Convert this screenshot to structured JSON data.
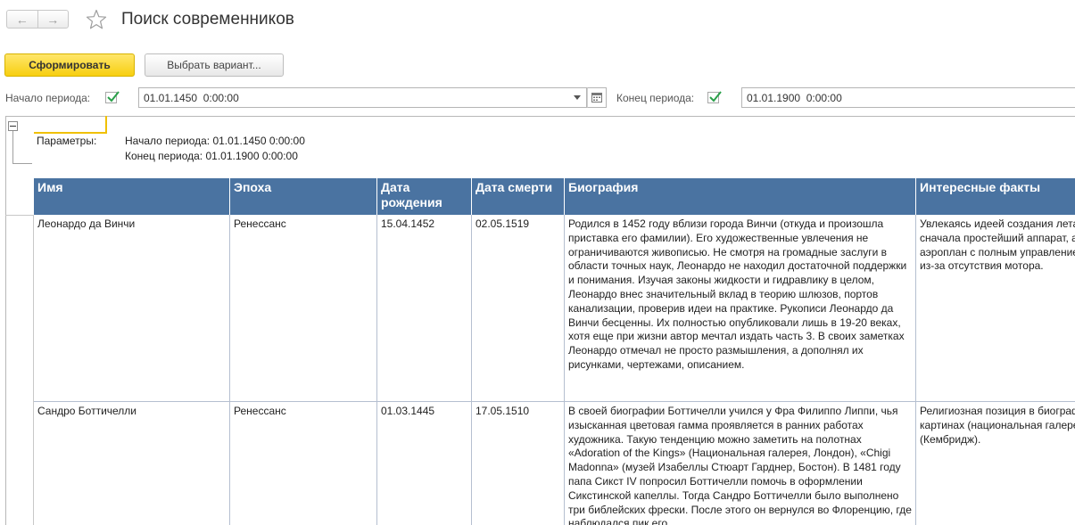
{
  "window": {
    "title": "Поиск современников"
  },
  "nav": {
    "back_glyph": "←",
    "forward_glyph": "→",
    "favorite_icon": "star-outline-icon"
  },
  "toolbar": {
    "generate_label": "Сформировать",
    "variant_label": "Выбрать вариант..."
  },
  "filters": {
    "start_label": "Начало периода:",
    "start_checked": true,
    "start_value": "01.01.1450  0:00:00",
    "end_label": "Конец периода:",
    "end_checked": true,
    "end_value": "01.01.1900  0:00:00"
  },
  "params": {
    "label": "Параметры:",
    "line1": "Начало периода: 01.01.1450 0:00:00",
    "line2": "Конец периода: 01.01.1900 0:00:00"
  },
  "table": {
    "headers": [
      "Имя",
      "Эпоха",
      "Дата рождения",
      "Дата смерти",
      "Биография",
      "Интересные факты"
    ],
    "rows": [
      {
        "name": "Леонардо да Винчи",
        "epoch": "Ренессанс",
        "birth": "15.04.1452",
        "death": "02.05.1519",
        "bio": "Родился в 1452 году вблизи города Винчи (откуда и произошла приставка его фамилии). Его художественные увлечения не ограничиваются живописью. Не смотря на громадные заслуги в области точных наук, Леонардо не находил достаточной поддержки и понимания. Изучая законы жидкости и гидравлику в целом, Леонардо внес значительный вклад в теорию шлюзов, портов канализации, проверив идеи на практике. Рукописи Леонардо да Винчи бесценны. Их полностью опубликовали лишь в 19-20 веках, хотя еще при жизни автор мечтал издать часть 3. В своих заметках Леонардо отмечал не просто размышления, а дополнял их рисунками, чертежами, описанием.",
        "facts": "Увлекаясь идеей создания летательного аппарата, он сначала простейший аппарат, а затем разработал аэроплан с полным управлением, который не взлетел из-за отсутствия мотора."
      },
      {
        "name": "Сандро Боттичелли",
        "epoch": "Ренессанс",
        "birth": "01.03.1445",
        "death": "17.05.1510",
        "bio": "В своей биографии Боттичелли учился у Фра Филиппо Липпи, чья изысканная цветовая гамма проявляется в ранних работах художника. Такую тенденцию можно заметить на полотнах «Adoration of the Kings» (Национальная галерея, Лондон), «Chigi Madonna» (музей Изабеллы Стюарт Гарднер, Бостон). В 1481 году папа Сикст IV попросил Боттичелли помочь в оформлении Сикстинской капеллы. Тогда Сандро Боттичелли было выполнено три библейских фрески. После этого он вернулся во Флоренцию, где наблюдался пик его",
        "facts": "Религиозная позиция в биографии отразилась в картинах (национальная галерея, Лондон), «Pieta» (Кембридж)."
      }
    ]
  }
}
